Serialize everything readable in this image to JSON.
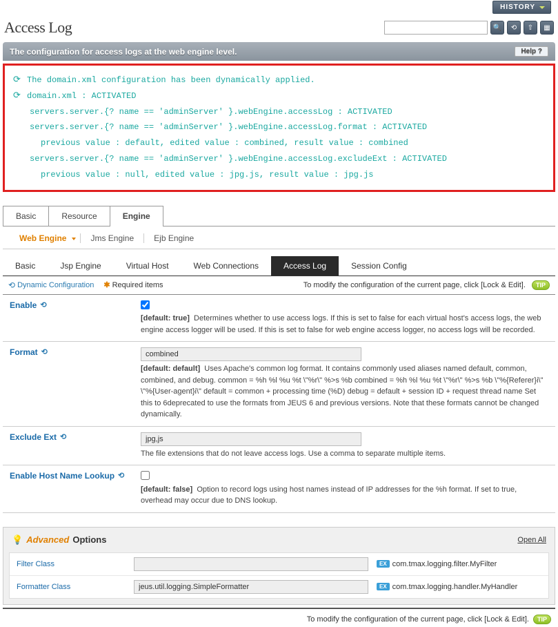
{
  "header": {
    "history_btn": "HISTORY",
    "page_title": "Access Log",
    "search_placeholder": "",
    "help_btn": "Help",
    "banner_text": "The configuration for access logs at the web engine level."
  },
  "notice": {
    "line1": "The domain.xml configuration has been dynamically applied.",
    "line2": "domain.xml : ACTIVATED",
    "line3": "servers.server.{? name == 'adminServer' }.webEngine.accessLog : ACTIVATED",
    "line4": "servers.server.{? name == 'adminServer' }.webEngine.accessLog.format : ACTIVATED",
    "line5": "previous value : default, edited value : combined, result value : combined",
    "line6": "servers.server.{? name == 'adminServer' }.webEngine.accessLog.excludeExt : ACTIVATED",
    "line7": "previous value : null, edited value : jpg.js, result value : jpg.js"
  },
  "main_tabs": {
    "basic": "Basic",
    "resource": "Resource",
    "engine": "Engine"
  },
  "sub_tabs": {
    "web": "Web Engine",
    "jms": "Jms Engine",
    "ejb": "Ejb Engine"
  },
  "nav_tabs": {
    "basic": "Basic",
    "jsp": "Jsp Engine",
    "vhost": "Virtual Host",
    "webconn": "Web Connections",
    "access": "Access Log",
    "session": "Session Config"
  },
  "info_bar": {
    "dyn_conf": "Dynamic Configuration",
    "req_items": "Required items",
    "modify_text": "To modify the configuration of the current page, click [Lock & Edit].",
    "tip": "TIP"
  },
  "fields": {
    "enable": {
      "label": "Enable",
      "default": "[default: true]",
      "desc": "Determines whether to use access logs. If this is set to false for each virtual host's access logs, the web engine access logger will be used. If this is set to false for web engine access logger, no access logs will be recorded."
    },
    "format": {
      "label": "Format",
      "value": "combined",
      "default": "[default: default]",
      "desc": "Uses Apache's common log format. It contains commonly used aliases named default, common, combined, and debug. common = %h %l %u %t \\\"%r\\\" %>s %b combined = %h %l %u %t \\\"%r\\\" %>s %b \\\"%{Referer}i\\\" \\\"%{User-agent}i\\\" default = common + processing time (%D) debug = default + session ID + request thread name Set this to 6deprecated to use the formats from JEUS 6 and previous versions. Note that these formats cannot be changed dynamically."
    },
    "exclude": {
      "label": "Exclude Ext",
      "value": "jpg,js",
      "desc": "The file extensions that do not leave access logs. Use a comma to separate multiple items."
    },
    "hostname": {
      "label": "Enable Host Name Lookup",
      "default": "[default: false]",
      "desc": "Option to record logs using host names instead of IP addresses for the %h format. If set to true, overhead may occur due to DNS lookup."
    }
  },
  "advanced": {
    "title_em": "Advanced",
    "title_rest": "Options",
    "open_all": "Open All",
    "filter_class": {
      "label": "Filter Class",
      "value": "",
      "example": "com.tmax.logging.filter.MyFilter"
    },
    "formatter_class": {
      "label": "Formatter Class",
      "value": "jeus.util.logging.SimpleFormatter",
      "example": "com.tmax.logging.handler.MyHandler"
    }
  },
  "bottom": {
    "modify_text": "To modify the configuration of the current page, click [Lock & Edit].",
    "tip": "TIP"
  }
}
